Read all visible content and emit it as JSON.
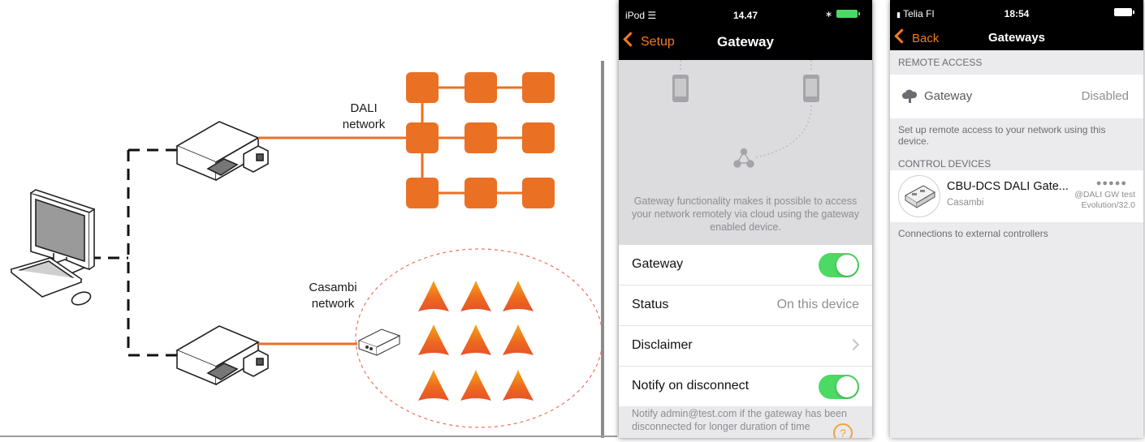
{
  "diagram": {
    "dali_label_1": "DALI",
    "dali_label_2": "network",
    "casambi_label_1": "Casambi",
    "casambi_label_2": "network",
    "colors": {
      "orange": "#ea7024",
      "dashed": "#111111",
      "ring": "#f0705a"
    }
  },
  "phone1": {
    "status": {
      "carrier": "iPod",
      "time": "14.47"
    },
    "back_label": "Setup",
    "title": "Gateway",
    "info_text": "Gateway functionality makes it possible to access your network remotely via cloud using the gateway enabled device.",
    "rows": [
      {
        "label": "Gateway",
        "toggle": true
      },
      {
        "label": "Status",
        "value": "On this device"
      },
      {
        "label": "Disclaimer",
        "chevron": true
      },
      {
        "label": "Notify on disconnect",
        "toggle": true
      }
    ],
    "footnote": "Notify admin@test.com if the gateway has been disconnected for longer duration of time",
    "help_label": "?"
  },
  "phone2": {
    "status": {
      "carrier": "Telia FI",
      "time": "18:54"
    },
    "back_label": "Back",
    "title": "Gateways",
    "remote_access_header": "REMOTE ACCESS",
    "gateway_row": {
      "label": "Gateway",
      "value": "Disabled"
    },
    "setup_text": "Set up remote access to your network using this device.",
    "control_devices_header": "CONTROL DEVICES",
    "device": {
      "name": "CBU-DCS DALI Gate...",
      "subtitle": "Casambi",
      "signal": "●●●●●",
      "meta1": "@DALI GW test",
      "meta2": "Evolution/32.0"
    },
    "external_text": "Connections to external controllers"
  }
}
